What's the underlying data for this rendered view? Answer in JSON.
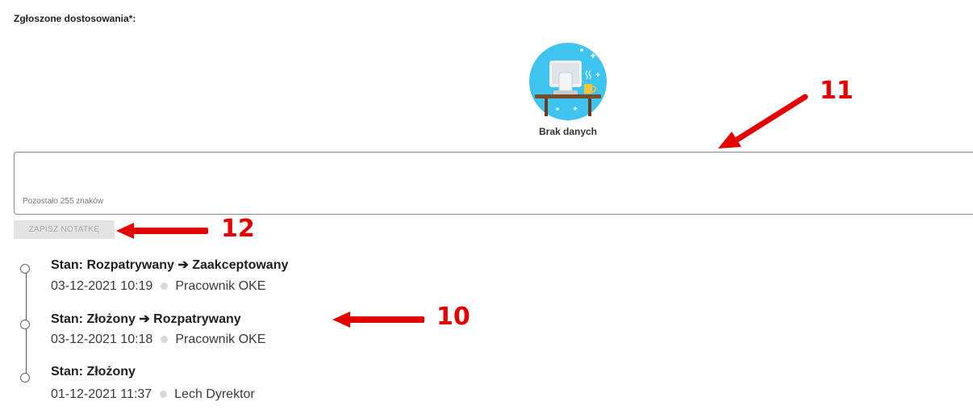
{
  "section": {
    "title": "Zgłoszone dostosowania*:"
  },
  "empty_state": {
    "text": "Brak danych",
    "illustration": "desk-computer-icon"
  },
  "note": {
    "value": "",
    "placeholder": "",
    "counter": "Pozostało 255 znaków"
  },
  "save_button": {
    "label": "ZAPISZ NOTATKĘ"
  },
  "timeline": [
    {
      "title": "Stan: Rozpatrywany ➔ Zaakceptowany",
      "date": "03-12-2021 10:19",
      "author": "Pracownik OKE"
    },
    {
      "title": "Stan: Złożony ➔ Rozpatrywany",
      "date": "03-12-2021 10:18",
      "author": "Pracownik OKE"
    },
    {
      "title": "Stan: Złożony",
      "date": "01-12-2021 11:37",
      "author": "Lech Dyrektor"
    }
  ],
  "annotations": [
    {
      "label": "11"
    },
    {
      "label": "12"
    },
    {
      "label": "10"
    }
  ],
  "colors": {
    "annotation": "#e30000",
    "illustration_bg": "#3ec4ef",
    "button_bg": "#e3e3e3"
  }
}
